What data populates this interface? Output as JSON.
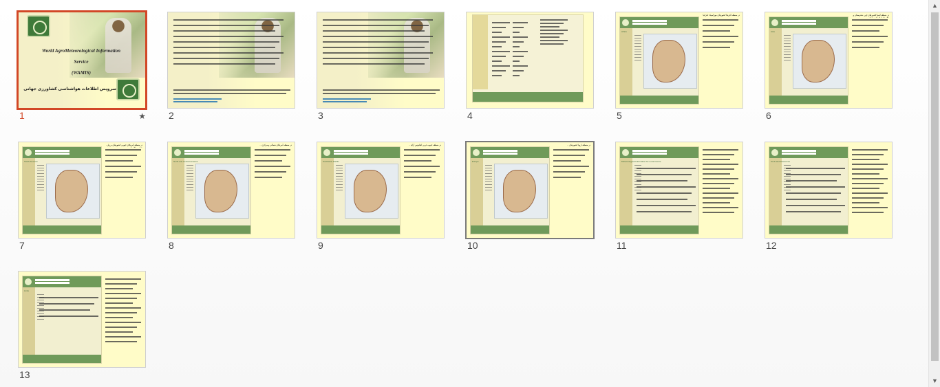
{
  "slides": [
    {
      "number": "1",
      "selected": true,
      "has_transition": true,
      "kind": "title",
      "title_lines": [
        "World AgroMeteorological Information",
        "Service",
        "(WAMIS)"
      ],
      "subtitle": "سرویس اطلاعات هواشناسی کشاورزی جهانی"
    },
    {
      "number": "2",
      "kind": "text-photo"
    },
    {
      "number": "3",
      "kind": "text-photo"
    },
    {
      "number": "4",
      "kind": "product-list"
    },
    {
      "number": "5",
      "kind": "map",
      "page_heading": "Africa",
      "caption": "در منطقه آفریقا کشورهای موزامبیک تانزانیا ..."
    },
    {
      "number": "6",
      "kind": "map",
      "page_heading": "Asia",
      "caption": "در منطقه آسیا کشورهای چین، هندوستان و پاکستان ارائه گردیده اند."
    },
    {
      "number": "7",
      "kind": "map",
      "page_heading": "South America",
      "caption": "در منطقه آمریکای جنوبی کشورهای برزیل، شیلی و کلمبیا ..."
    },
    {
      "number": "8",
      "kind": "map",
      "page_heading": "North and Central America",
      "caption": "در منطقه آمریکای شمالی و مرکزی ..."
    },
    {
      "number": "9",
      "kind": "map",
      "page_heading": "Southwest Pacific",
      "caption": "در منطقه جنوب غربی اقیانوس آرام ..."
    },
    {
      "number": "10",
      "hover": true,
      "kind": "map",
      "page_heading": "Europe",
      "caption": "در منطقه اروپا کشورهای ..."
    },
    {
      "number": "11",
      "kind": "text-web",
      "page_heading": "Meteorological Information for Local Centre"
    },
    {
      "number": "12",
      "kind": "text-web",
      "page_heading": "Tools and Resources"
    },
    {
      "number": "13",
      "kind": "links-web",
      "page_heading": "Links"
    }
  ],
  "icons": {
    "transition": "star-icon",
    "scroll_up": "triangle-up-icon",
    "scroll_down": "triangle-down-icon"
  },
  "colors": {
    "selected_border": "#d24726",
    "slide_background": "#fffcc8",
    "header_green": "#6f9a5a"
  }
}
